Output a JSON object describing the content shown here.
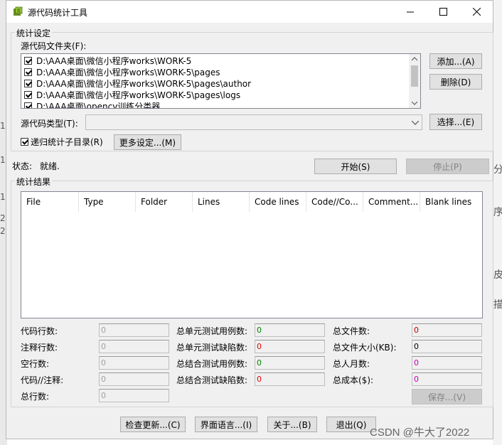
{
  "window": {
    "title": "源代码统计工具"
  },
  "stats_settings": {
    "group_label": "统计设定",
    "folders_label": "源代码文件夹(F):",
    "folders": [
      "D:\\AAA桌面\\微信小程序works\\WORK-5",
      "D:\\AAA桌面\\微信小程序works\\WORK-5\\pages",
      "D:\\AAA桌面\\微信小程序works\\WORK-5\\pages\\author",
      "D:\\AAA桌面\\微信小程序works\\WORK-5\\pages\\logs",
      "D:\\AAA桌面\\opencv训练分类器"
    ],
    "add_button": "添加...(A)",
    "delete_button": "删除(D)",
    "type_label": "源代码类型(T):",
    "type_value": "",
    "choose_button": "选择...(E)",
    "recursive_label": "递归统计子目录(R)",
    "more_settings_button": "更多设定...(M)"
  },
  "status": {
    "label": "状态:",
    "value": "就绪."
  },
  "actions": {
    "start": "开始(S)",
    "stop": "停止(P)"
  },
  "results": {
    "group_label": "统计结果",
    "columns": [
      "File",
      "Type",
      "Folder",
      "Lines",
      "Code lines",
      "Code//Co...",
      "Comment...",
      "Blank lines"
    ],
    "left": [
      {
        "label": "代码行数:",
        "value": "0"
      },
      {
        "label": "注释行数:",
        "value": "0"
      },
      {
        "label": "空行数:",
        "value": "0"
      },
      {
        "label": "代码//注释:",
        "value": "0"
      },
      {
        "label": "总行数:",
        "value": "0"
      }
    ],
    "middle": [
      {
        "label": "总单元测试用例数:",
        "value": "0",
        "color": "#008000"
      },
      {
        "label": "总单元测试缺陷数:",
        "value": "0",
        "color": "#e00000"
      },
      {
        "label": "总结合测试用例数:",
        "value": "0",
        "color": "#008000"
      },
      {
        "label": "总结合测试缺陷数:",
        "value": "0",
        "color": "#e00000"
      }
    ],
    "right": [
      {
        "label": "总文件数:",
        "value": "0",
        "color": "#c00000"
      },
      {
        "label": "总文件大小(KB):",
        "value": "0",
        "color": "#000000"
      },
      {
        "label": "总人月数:",
        "value": "0",
        "color": "#c000c0"
      },
      {
        "label": "总成本($):",
        "value": "0",
        "color": "#c000c0"
      }
    ],
    "save_button": "保存...(V)"
  },
  "footer": {
    "check_update": "检查更新...(C)",
    "language": "界面语言...(I)",
    "about": "关于...(B)",
    "exit": "退出(Q)"
  },
  "background": {
    "watermark": "CSDN @牛大了2022",
    "side_chars": [
      "分",
      "序",
      "皮",
      "描"
    ],
    "left_digits": [
      "1",
      "1",
      "1",
      "2",
      "2"
    ]
  }
}
